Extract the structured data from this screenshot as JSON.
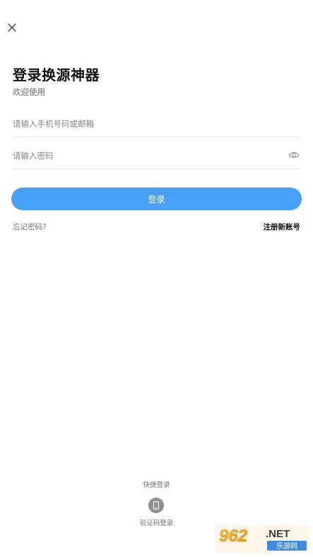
{
  "header": {
    "close_icon": "close-icon"
  },
  "login": {
    "title": "登录换源神器",
    "subtitle": "欢迎使用",
    "phone_placeholder": "请输入手机号码或邮箱",
    "password_placeholder": "请输入密码",
    "eye_icon": "eye-icon",
    "login_button": "登录",
    "forgot_password": "忘记密码?",
    "register": "注册新账号"
  },
  "quick_login": {
    "label": "快捷登录",
    "sms_icon": "phone-icon",
    "sms_label": "验证码登录"
  },
  "watermark": {
    "brand": "962",
    "domain": ".NET",
    "site_name": "乐游网"
  },
  "colors": {
    "accent": "#48a1f7",
    "title": "#111111",
    "muted": "#777777",
    "divider": "#e6e6e6"
  }
}
